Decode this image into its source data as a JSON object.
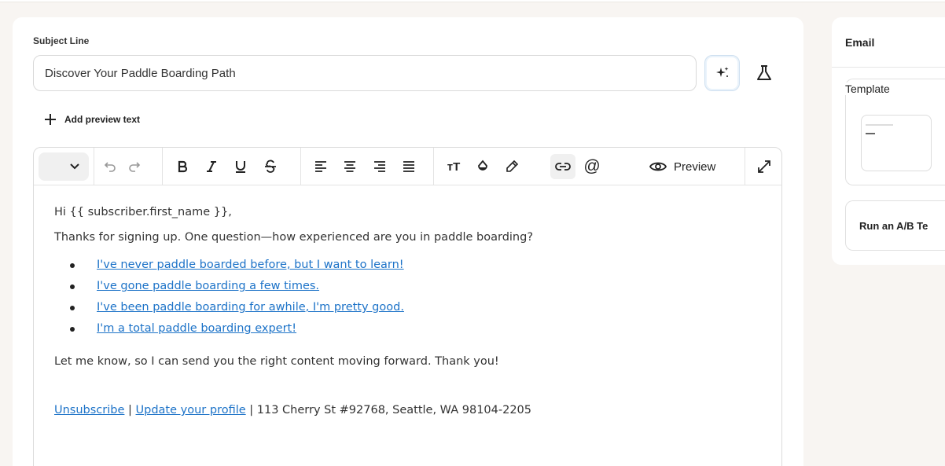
{
  "subject": {
    "label": "Subject Line",
    "value": "Discover Your Paddle Boarding Path"
  },
  "preview_text": {
    "label": "Add preview text"
  },
  "toolbar": {
    "preview_label": "Preview",
    "font_size_icon": "тТ",
    "mention_icon": "@"
  },
  "email_body": {
    "greeting": "Hi {{ subscriber.first_name }},",
    "intro": "Thanks for signing up. One question—how experienced are you in paddle boarding?",
    "options": [
      "I've never paddle boarded before, but I want to learn!",
      "I've gone paddle boarding a few times.",
      "I've been paddle boarding for awhile, I'm pretty good.",
      "I'm a total paddle boarding expert!"
    ],
    "closing": "Let me know, so I can send you the right content moving forward. Thank you!",
    "footer": {
      "unsubscribe": "Unsubscribe",
      "separator1": " | ",
      "update_profile": "Update your profile",
      "address": " | 113 Cherry St #92768, Seattle, WA 98104-2205"
    }
  },
  "side_panel": {
    "title": "Email",
    "template_label": "Template",
    "ab_test_label": "Run an A/B Te"
  },
  "colors": {
    "background": "#f8f5f2",
    "link": "#1d73c8",
    "card": "#ffffff"
  }
}
